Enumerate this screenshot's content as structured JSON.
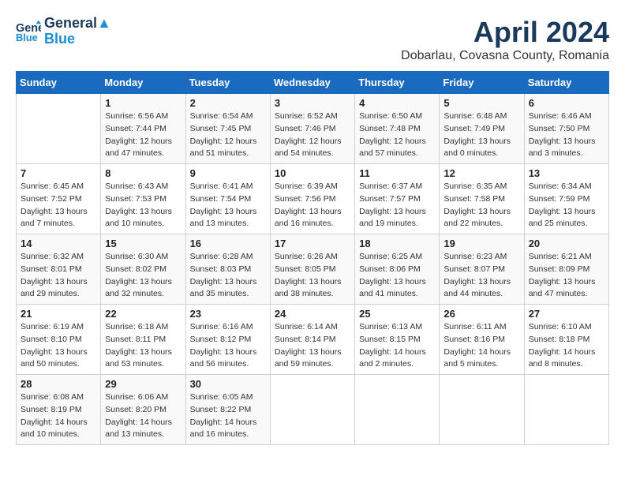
{
  "header": {
    "logo_line1": "General",
    "logo_line2": "Blue",
    "title": "April 2024",
    "subtitle": "Dobarlau, Covasna County, Romania"
  },
  "calendar": {
    "weekdays": [
      "Sunday",
      "Monday",
      "Tuesday",
      "Wednesday",
      "Thursday",
      "Friday",
      "Saturday"
    ],
    "weeks": [
      [
        {
          "day": "",
          "info": ""
        },
        {
          "day": "1",
          "info": "Sunrise: 6:56 AM\nSunset: 7:44 PM\nDaylight: 12 hours\nand 47 minutes."
        },
        {
          "day": "2",
          "info": "Sunrise: 6:54 AM\nSunset: 7:45 PM\nDaylight: 12 hours\nand 51 minutes."
        },
        {
          "day": "3",
          "info": "Sunrise: 6:52 AM\nSunset: 7:46 PM\nDaylight: 12 hours\nand 54 minutes."
        },
        {
          "day": "4",
          "info": "Sunrise: 6:50 AM\nSunset: 7:48 PM\nDaylight: 12 hours\nand 57 minutes."
        },
        {
          "day": "5",
          "info": "Sunrise: 6:48 AM\nSunset: 7:49 PM\nDaylight: 13 hours\nand 0 minutes."
        },
        {
          "day": "6",
          "info": "Sunrise: 6:46 AM\nSunset: 7:50 PM\nDaylight: 13 hours\nand 3 minutes."
        }
      ],
      [
        {
          "day": "7",
          "info": "Sunrise: 6:45 AM\nSunset: 7:52 PM\nDaylight: 13 hours\nand 7 minutes."
        },
        {
          "day": "8",
          "info": "Sunrise: 6:43 AM\nSunset: 7:53 PM\nDaylight: 13 hours\nand 10 minutes."
        },
        {
          "day": "9",
          "info": "Sunrise: 6:41 AM\nSunset: 7:54 PM\nDaylight: 13 hours\nand 13 minutes."
        },
        {
          "day": "10",
          "info": "Sunrise: 6:39 AM\nSunset: 7:56 PM\nDaylight: 13 hours\nand 16 minutes."
        },
        {
          "day": "11",
          "info": "Sunrise: 6:37 AM\nSunset: 7:57 PM\nDaylight: 13 hours\nand 19 minutes."
        },
        {
          "day": "12",
          "info": "Sunrise: 6:35 AM\nSunset: 7:58 PM\nDaylight: 13 hours\nand 22 minutes."
        },
        {
          "day": "13",
          "info": "Sunrise: 6:34 AM\nSunset: 7:59 PM\nDaylight: 13 hours\nand 25 minutes."
        }
      ],
      [
        {
          "day": "14",
          "info": "Sunrise: 6:32 AM\nSunset: 8:01 PM\nDaylight: 13 hours\nand 29 minutes."
        },
        {
          "day": "15",
          "info": "Sunrise: 6:30 AM\nSunset: 8:02 PM\nDaylight: 13 hours\nand 32 minutes."
        },
        {
          "day": "16",
          "info": "Sunrise: 6:28 AM\nSunset: 8:03 PM\nDaylight: 13 hours\nand 35 minutes."
        },
        {
          "day": "17",
          "info": "Sunrise: 6:26 AM\nSunset: 8:05 PM\nDaylight: 13 hours\nand 38 minutes."
        },
        {
          "day": "18",
          "info": "Sunrise: 6:25 AM\nSunset: 8:06 PM\nDaylight: 13 hours\nand 41 minutes."
        },
        {
          "day": "19",
          "info": "Sunrise: 6:23 AM\nSunset: 8:07 PM\nDaylight: 13 hours\nand 44 minutes."
        },
        {
          "day": "20",
          "info": "Sunrise: 6:21 AM\nSunset: 8:09 PM\nDaylight: 13 hours\nand 47 minutes."
        }
      ],
      [
        {
          "day": "21",
          "info": "Sunrise: 6:19 AM\nSunset: 8:10 PM\nDaylight: 13 hours\nand 50 minutes."
        },
        {
          "day": "22",
          "info": "Sunrise: 6:18 AM\nSunset: 8:11 PM\nDaylight: 13 hours\nand 53 minutes."
        },
        {
          "day": "23",
          "info": "Sunrise: 6:16 AM\nSunset: 8:12 PM\nDaylight: 13 hours\nand 56 minutes."
        },
        {
          "day": "24",
          "info": "Sunrise: 6:14 AM\nSunset: 8:14 PM\nDaylight: 13 hours\nand 59 minutes."
        },
        {
          "day": "25",
          "info": "Sunrise: 6:13 AM\nSunset: 8:15 PM\nDaylight: 14 hours\nand 2 minutes."
        },
        {
          "day": "26",
          "info": "Sunrise: 6:11 AM\nSunset: 8:16 PM\nDaylight: 14 hours\nand 5 minutes."
        },
        {
          "day": "27",
          "info": "Sunrise: 6:10 AM\nSunset: 8:18 PM\nDaylight: 14 hours\nand 8 minutes."
        }
      ],
      [
        {
          "day": "28",
          "info": "Sunrise: 6:08 AM\nSunset: 8:19 PM\nDaylight: 14 hours\nand 10 minutes."
        },
        {
          "day": "29",
          "info": "Sunrise: 6:06 AM\nSunset: 8:20 PM\nDaylight: 14 hours\nand 13 minutes."
        },
        {
          "day": "30",
          "info": "Sunrise: 6:05 AM\nSunset: 8:22 PM\nDaylight: 14 hours\nand 16 minutes."
        },
        {
          "day": "",
          "info": ""
        },
        {
          "day": "",
          "info": ""
        },
        {
          "day": "",
          "info": ""
        },
        {
          "day": "",
          "info": ""
        }
      ]
    ]
  }
}
